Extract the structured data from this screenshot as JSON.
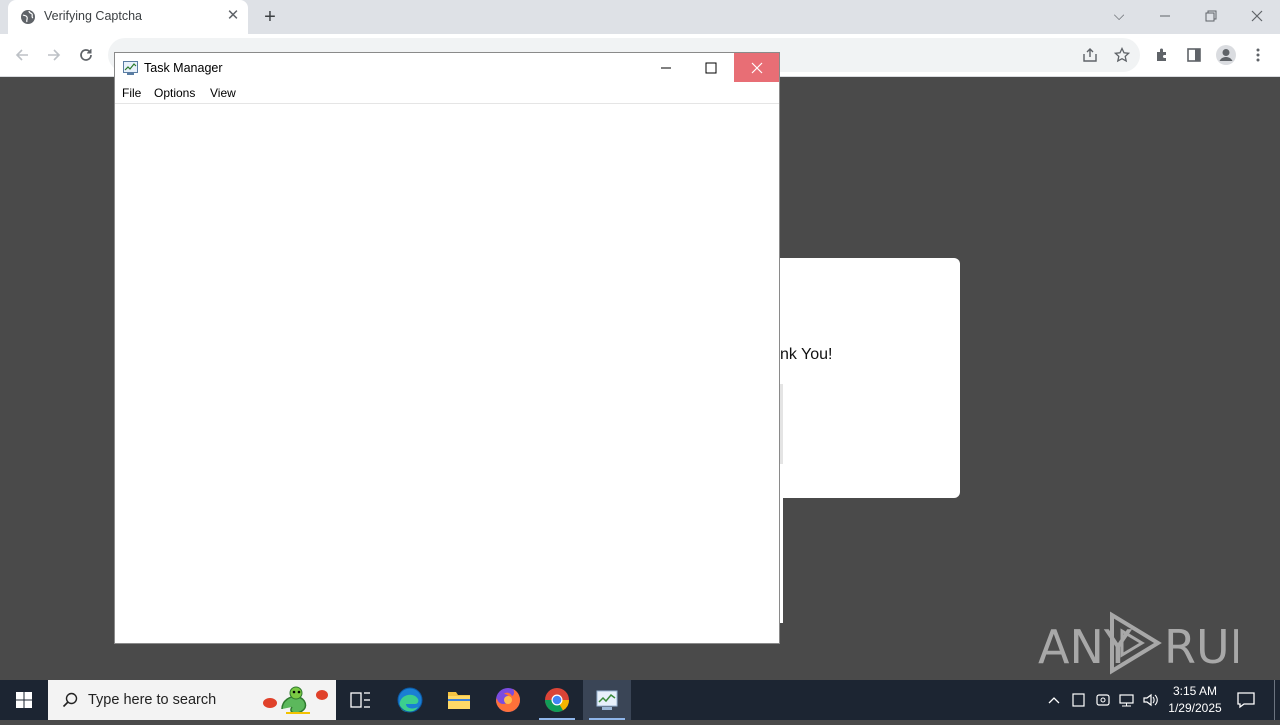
{
  "browser": {
    "tab_title": "Verifying Captcha",
    "tab_close": "✕",
    "new_tab": "+",
    "url": "",
    "window_controls": {
      "chevron": "⌵",
      "minimize": "—",
      "restore": "❐",
      "close": "✕"
    }
  },
  "page": {
    "captcha_text": "nk You!",
    "watermark": "ANY RUN"
  },
  "task_manager": {
    "title": "Task Manager",
    "menu": [
      "File",
      "Options",
      "View"
    ],
    "controls": {
      "minimize": "—",
      "maximize": "☐",
      "close": "✕"
    }
  },
  "taskbar": {
    "search_placeholder": "Type here to search",
    "pinned": [
      "task-view",
      "edge",
      "file-explorer",
      "firefox",
      "chrome",
      "task-manager"
    ],
    "active_app": "task-manager",
    "clock_time": "3:15 AM",
    "clock_date": "1/29/2025"
  },
  "colors": {
    "chrome_tabbar": "#dee1e6",
    "page_bg": "#4a4a4a",
    "taskbar_bg": "#1c2532",
    "tm_close_bg": "#e86e75"
  }
}
